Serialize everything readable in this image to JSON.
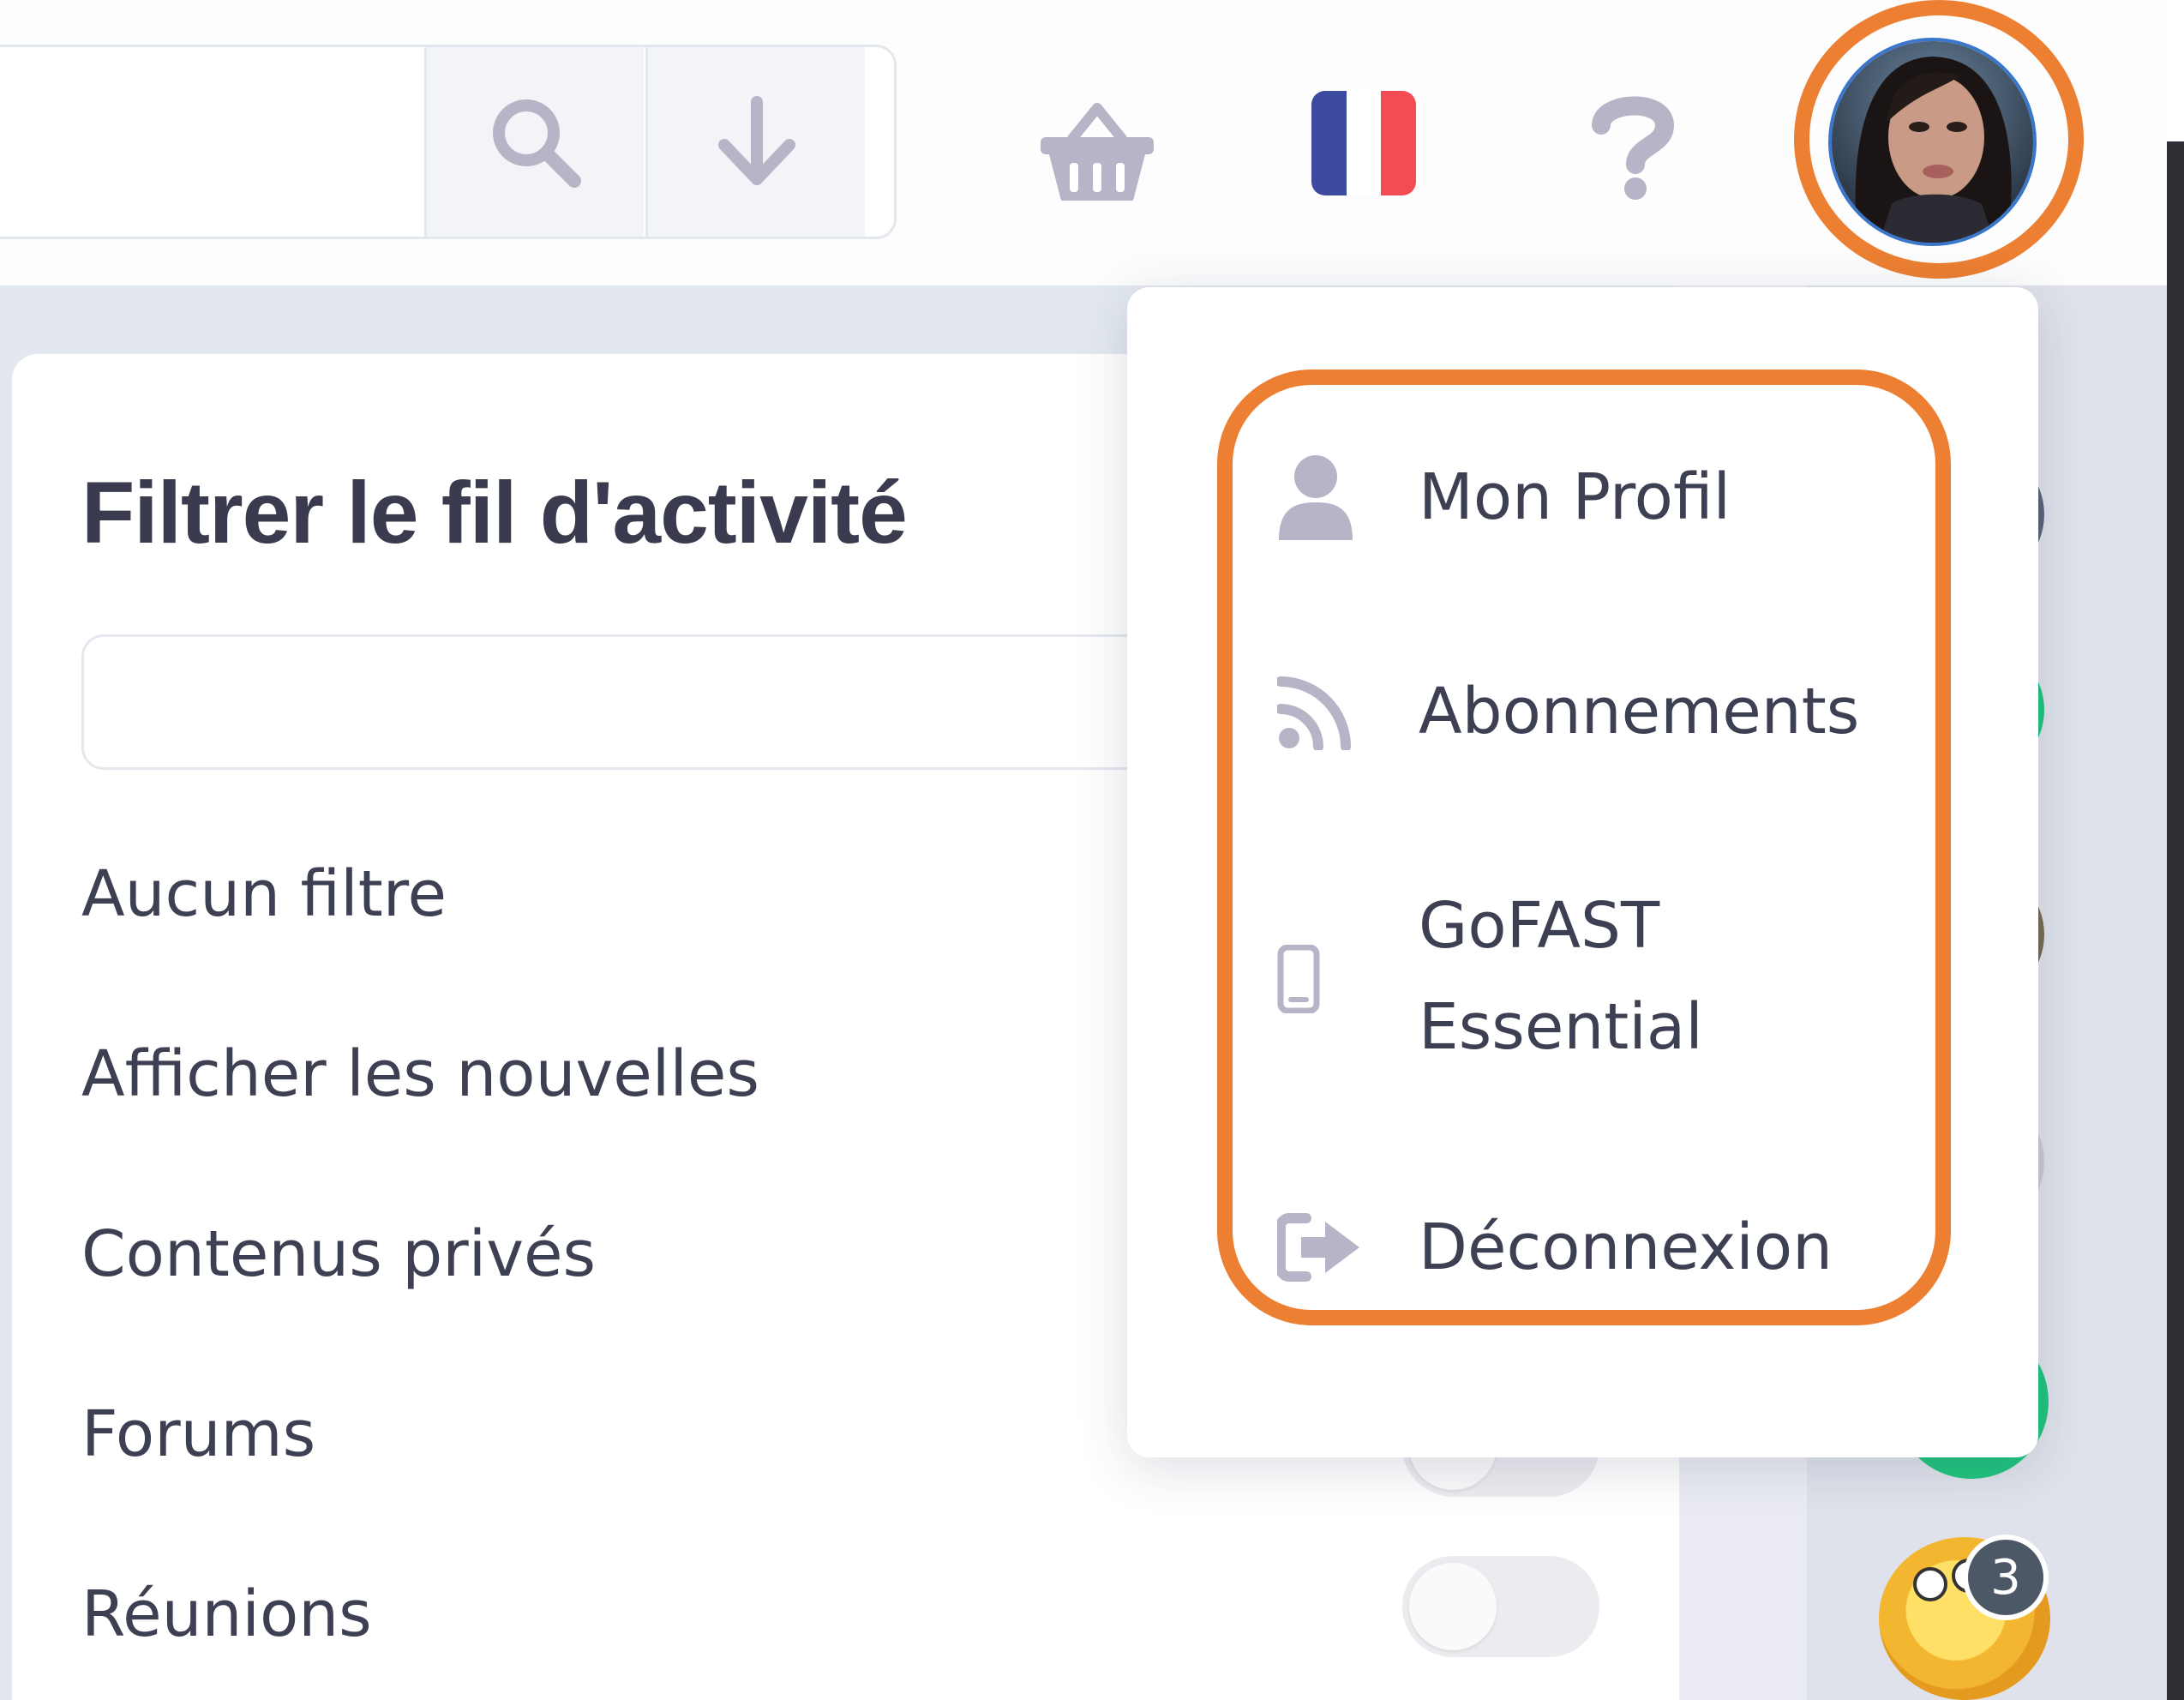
{
  "header": {
    "search_icon": "search-icon",
    "download_icon": "arrow-down-icon",
    "basket_icon": "basket-icon",
    "language_icon": "french-flag-icon",
    "help_icon": "question-mark-icon",
    "avatar_icon": "user-avatar"
  },
  "panel": {
    "title": "Filtrer le fil d'activité",
    "filters": [
      {
        "label": "Aucun filtre"
      },
      {
        "label": "Afficher les nouvelles"
      },
      {
        "label": "Contenus privés"
      },
      {
        "label": "Forums"
      },
      {
        "label": "Réunions"
      }
    ]
  },
  "user_menu": {
    "items": [
      {
        "label": "Mon Profil",
        "icon": "user-icon"
      },
      {
        "label": "Abonnements",
        "icon": "rss-icon"
      },
      {
        "label": "GoFAST Essential",
        "label_line1": "GoFAST",
        "label_line2": "Essential",
        "icon": "mobile-phone-icon"
      },
      {
        "label": "Déconnexion",
        "icon": "logout-icon"
      }
    ]
  },
  "notifications": {
    "badge_count": "3"
  },
  "colors": {
    "highlight": "#ec7f32",
    "icon_gray": "#b6b4c6",
    "text": "#3d3f52",
    "green": "#21c47e",
    "badge": "#4d5867"
  }
}
